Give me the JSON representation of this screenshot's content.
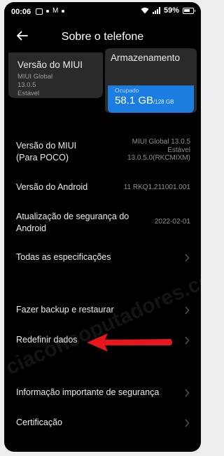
{
  "status_bar": {
    "time": "00:06",
    "battery": "59%"
  },
  "header": {
    "title": "Sobre o telefone"
  },
  "cards": {
    "version": {
      "title": "Versão do MIUI",
      "line1": "MIUI Global",
      "line2": "13.0.5",
      "line3": "Estável"
    },
    "storage": {
      "title": "Armazenamento",
      "used_label": "Ocupado",
      "used_value": "58.1 GB",
      "total": "/128 GB"
    }
  },
  "rows": [
    {
      "label": "Versão do MIUI (Para POCO)",
      "value_lines": [
        "MIUI Global 13.0.5",
        "Estável",
        "13.0.5.0(RKCMIXM)"
      ]
    },
    {
      "label": "Versão do Android",
      "value": "11 RKQ1.211001.001"
    },
    {
      "label": "Atualização de segurança do Android",
      "value": "2022-02-01"
    },
    {
      "label": "Todas as especificações"
    },
    {
      "label": "Fazer backup e restaurar"
    },
    {
      "label": "Redefinir dados"
    },
    {
      "label": "Informação importante de segurança"
    },
    {
      "label": "Certificação"
    }
  ],
  "watermark": "ciaconcoputadores.com",
  "colors": {
    "background": "#000000",
    "card": "#2a2a2a",
    "storage_fill": "#1b7de0",
    "arrow": "#e8161c"
  }
}
